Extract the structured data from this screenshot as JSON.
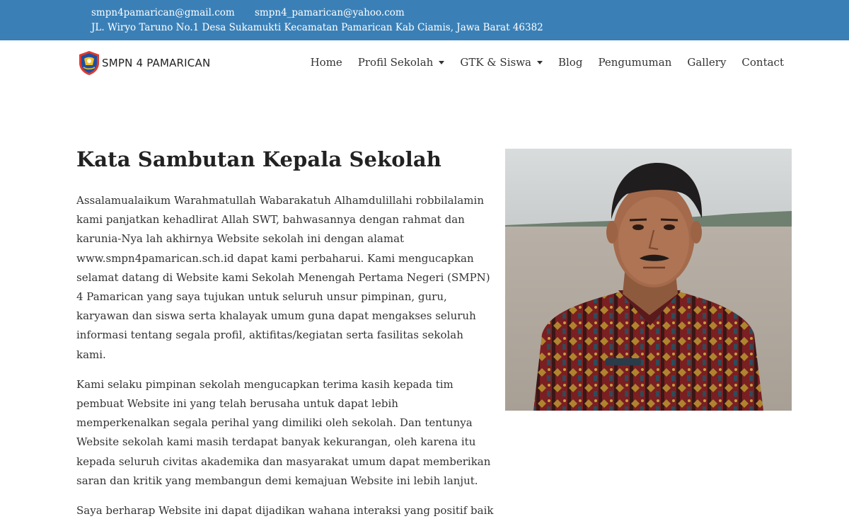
{
  "topbar": {
    "email_primary": "smpn4pamarican@gmail.com",
    "email_secondary": "smpn4_pamarican@yahoo.com",
    "address": "JL. Wiryo Taruno No.1 Desa Sukamukti Kecamatan Pamarican Kab Ciamis, Jawa Barat 46382"
  },
  "brand": {
    "name": "SMPN 4 PAMARICAN",
    "logo_icon": "school-logo-icon"
  },
  "nav": {
    "home": "Home",
    "profil": "Profil Sekolah",
    "gtk": "GTK & Siswa",
    "blog": "Blog",
    "pengumuman": "Pengumuman",
    "gallery": "Gallery",
    "contact": "Contact"
  },
  "main": {
    "title": "Kata Sambutan Kepala Sekolah",
    "paragraphs": [
      "Assalamualaikum Warahmatullah Wabarakatuh Alhamdulillahi robbilalamin kami panjatkan kehadlirat Allah SWT, bahwasannya dengan rahmat dan karunia-Nya lah akhirnya Website sekolah ini dengan alamat www.smpn4pamarican.sch.id dapat kami perbaharui. Kami mengucapkan selamat datang di Website kami Sekolah Menengah Pertama Negeri (SMPN) 4 Pamarican yang saya tujukan untuk seluruh unsur pimpinan, guru, karyawan dan siswa serta khalayak umum guna dapat mengakses seluruh informasi tentang segala profil, aktifitas/kegiatan serta fasilitas sekolah kami.",
      "Kami selaku pimpinan sekolah mengucapkan terima kasih kepada tim pembuat Website ini yang telah berusaha untuk dapat lebih memperkenalkan segala perihal yang dimiliki oleh sekolah. Dan tentunya Website sekolah kami masih terdapat banyak kekurangan, oleh karena itu kepada seluruh civitas akademika dan masyarakat umum dapat memberikan saran dan kritik yang membangun demi kemajuan Website ini lebih lanjut.",
      "Saya berharap Website ini dapat dijadikan wahana interaksi yang positif baik"
    ]
  },
  "colors": {
    "topbar": "#3a80b7",
    "text": "#333333",
    "heading": "#222222"
  }
}
